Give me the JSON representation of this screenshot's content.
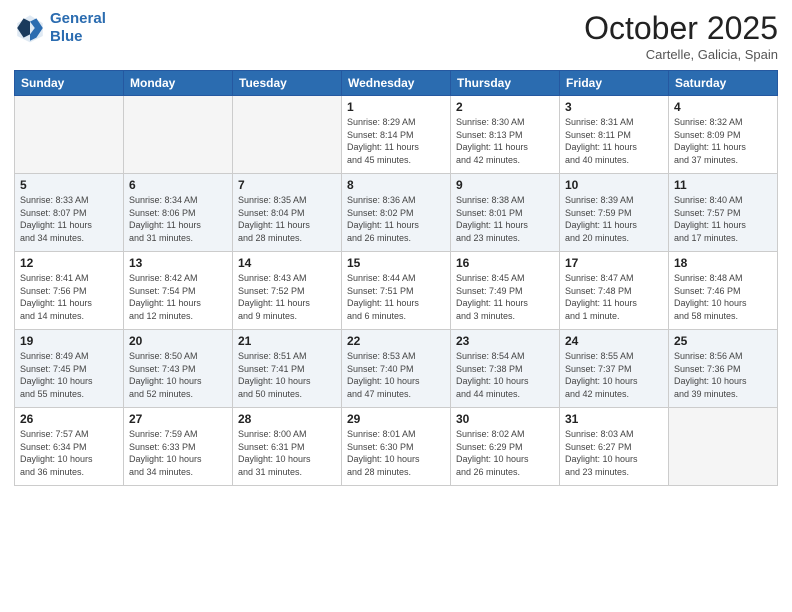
{
  "header": {
    "logo_line1": "General",
    "logo_line2": "Blue",
    "month": "October 2025",
    "location": "Cartelle, Galicia, Spain"
  },
  "weekdays": [
    "Sunday",
    "Monday",
    "Tuesday",
    "Wednesday",
    "Thursday",
    "Friday",
    "Saturday"
  ],
  "weeks": [
    [
      {
        "day": "",
        "info": ""
      },
      {
        "day": "",
        "info": ""
      },
      {
        "day": "",
        "info": ""
      },
      {
        "day": "1",
        "info": "Sunrise: 8:29 AM\nSunset: 8:14 PM\nDaylight: 11 hours\nand 45 minutes."
      },
      {
        "day": "2",
        "info": "Sunrise: 8:30 AM\nSunset: 8:13 PM\nDaylight: 11 hours\nand 42 minutes."
      },
      {
        "day": "3",
        "info": "Sunrise: 8:31 AM\nSunset: 8:11 PM\nDaylight: 11 hours\nand 40 minutes."
      },
      {
        "day": "4",
        "info": "Sunrise: 8:32 AM\nSunset: 8:09 PM\nDaylight: 11 hours\nand 37 minutes."
      }
    ],
    [
      {
        "day": "5",
        "info": "Sunrise: 8:33 AM\nSunset: 8:07 PM\nDaylight: 11 hours\nand 34 minutes."
      },
      {
        "day": "6",
        "info": "Sunrise: 8:34 AM\nSunset: 8:06 PM\nDaylight: 11 hours\nand 31 minutes."
      },
      {
        "day": "7",
        "info": "Sunrise: 8:35 AM\nSunset: 8:04 PM\nDaylight: 11 hours\nand 28 minutes."
      },
      {
        "day": "8",
        "info": "Sunrise: 8:36 AM\nSunset: 8:02 PM\nDaylight: 11 hours\nand 26 minutes."
      },
      {
        "day": "9",
        "info": "Sunrise: 8:38 AM\nSunset: 8:01 PM\nDaylight: 11 hours\nand 23 minutes."
      },
      {
        "day": "10",
        "info": "Sunrise: 8:39 AM\nSunset: 7:59 PM\nDaylight: 11 hours\nand 20 minutes."
      },
      {
        "day": "11",
        "info": "Sunrise: 8:40 AM\nSunset: 7:57 PM\nDaylight: 11 hours\nand 17 minutes."
      }
    ],
    [
      {
        "day": "12",
        "info": "Sunrise: 8:41 AM\nSunset: 7:56 PM\nDaylight: 11 hours\nand 14 minutes."
      },
      {
        "day": "13",
        "info": "Sunrise: 8:42 AM\nSunset: 7:54 PM\nDaylight: 11 hours\nand 12 minutes."
      },
      {
        "day": "14",
        "info": "Sunrise: 8:43 AM\nSunset: 7:52 PM\nDaylight: 11 hours\nand 9 minutes."
      },
      {
        "day": "15",
        "info": "Sunrise: 8:44 AM\nSunset: 7:51 PM\nDaylight: 11 hours\nand 6 minutes."
      },
      {
        "day": "16",
        "info": "Sunrise: 8:45 AM\nSunset: 7:49 PM\nDaylight: 11 hours\nand 3 minutes."
      },
      {
        "day": "17",
        "info": "Sunrise: 8:47 AM\nSunset: 7:48 PM\nDaylight: 11 hours\nand 1 minute."
      },
      {
        "day": "18",
        "info": "Sunrise: 8:48 AM\nSunset: 7:46 PM\nDaylight: 10 hours\nand 58 minutes."
      }
    ],
    [
      {
        "day": "19",
        "info": "Sunrise: 8:49 AM\nSunset: 7:45 PM\nDaylight: 10 hours\nand 55 minutes."
      },
      {
        "day": "20",
        "info": "Sunrise: 8:50 AM\nSunset: 7:43 PM\nDaylight: 10 hours\nand 52 minutes."
      },
      {
        "day": "21",
        "info": "Sunrise: 8:51 AM\nSunset: 7:41 PM\nDaylight: 10 hours\nand 50 minutes."
      },
      {
        "day": "22",
        "info": "Sunrise: 8:53 AM\nSunset: 7:40 PM\nDaylight: 10 hours\nand 47 minutes."
      },
      {
        "day": "23",
        "info": "Sunrise: 8:54 AM\nSunset: 7:38 PM\nDaylight: 10 hours\nand 44 minutes."
      },
      {
        "day": "24",
        "info": "Sunrise: 8:55 AM\nSunset: 7:37 PM\nDaylight: 10 hours\nand 42 minutes."
      },
      {
        "day": "25",
        "info": "Sunrise: 8:56 AM\nSunset: 7:36 PM\nDaylight: 10 hours\nand 39 minutes."
      }
    ],
    [
      {
        "day": "26",
        "info": "Sunrise: 7:57 AM\nSunset: 6:34 PM\nDaylight: 10 hours\nand 36 minutes."
      },
      {
        "day": "27",
        "info": "Sunrise: 7:59 AM\nSunset: 6:33 PM\nDaylight: 10 hours\nand 34 minutes."
      },
      {
        "day": "28",
        "info": "Sunrise: 8:00 AM\nSunset: 6:31 PM\nDaylight: 10 hours\nand 31 minutes."
      },
      {
        "day": "29",
        "info": "Sunrise: 8:01 AM\nSunset: 6:30 PM\nDaylight: 10 hours\nand 28 minutes."
      },
      {
        "day": "30",
        "info": "Sunrise: 8:02 AM\nSunset: 6:29 PM\nDaylight: 10 hours\nand 26 minutes."
      },
      {
        "day": "31",
        "info": "Sunrise: 8:03 AM\nSunset: 6:27 PM\nDaylight: 10 hours\nand 23 minutes."
      },
      {
        "day": "",
        "info": ""
      }
    ]
  ]
}
